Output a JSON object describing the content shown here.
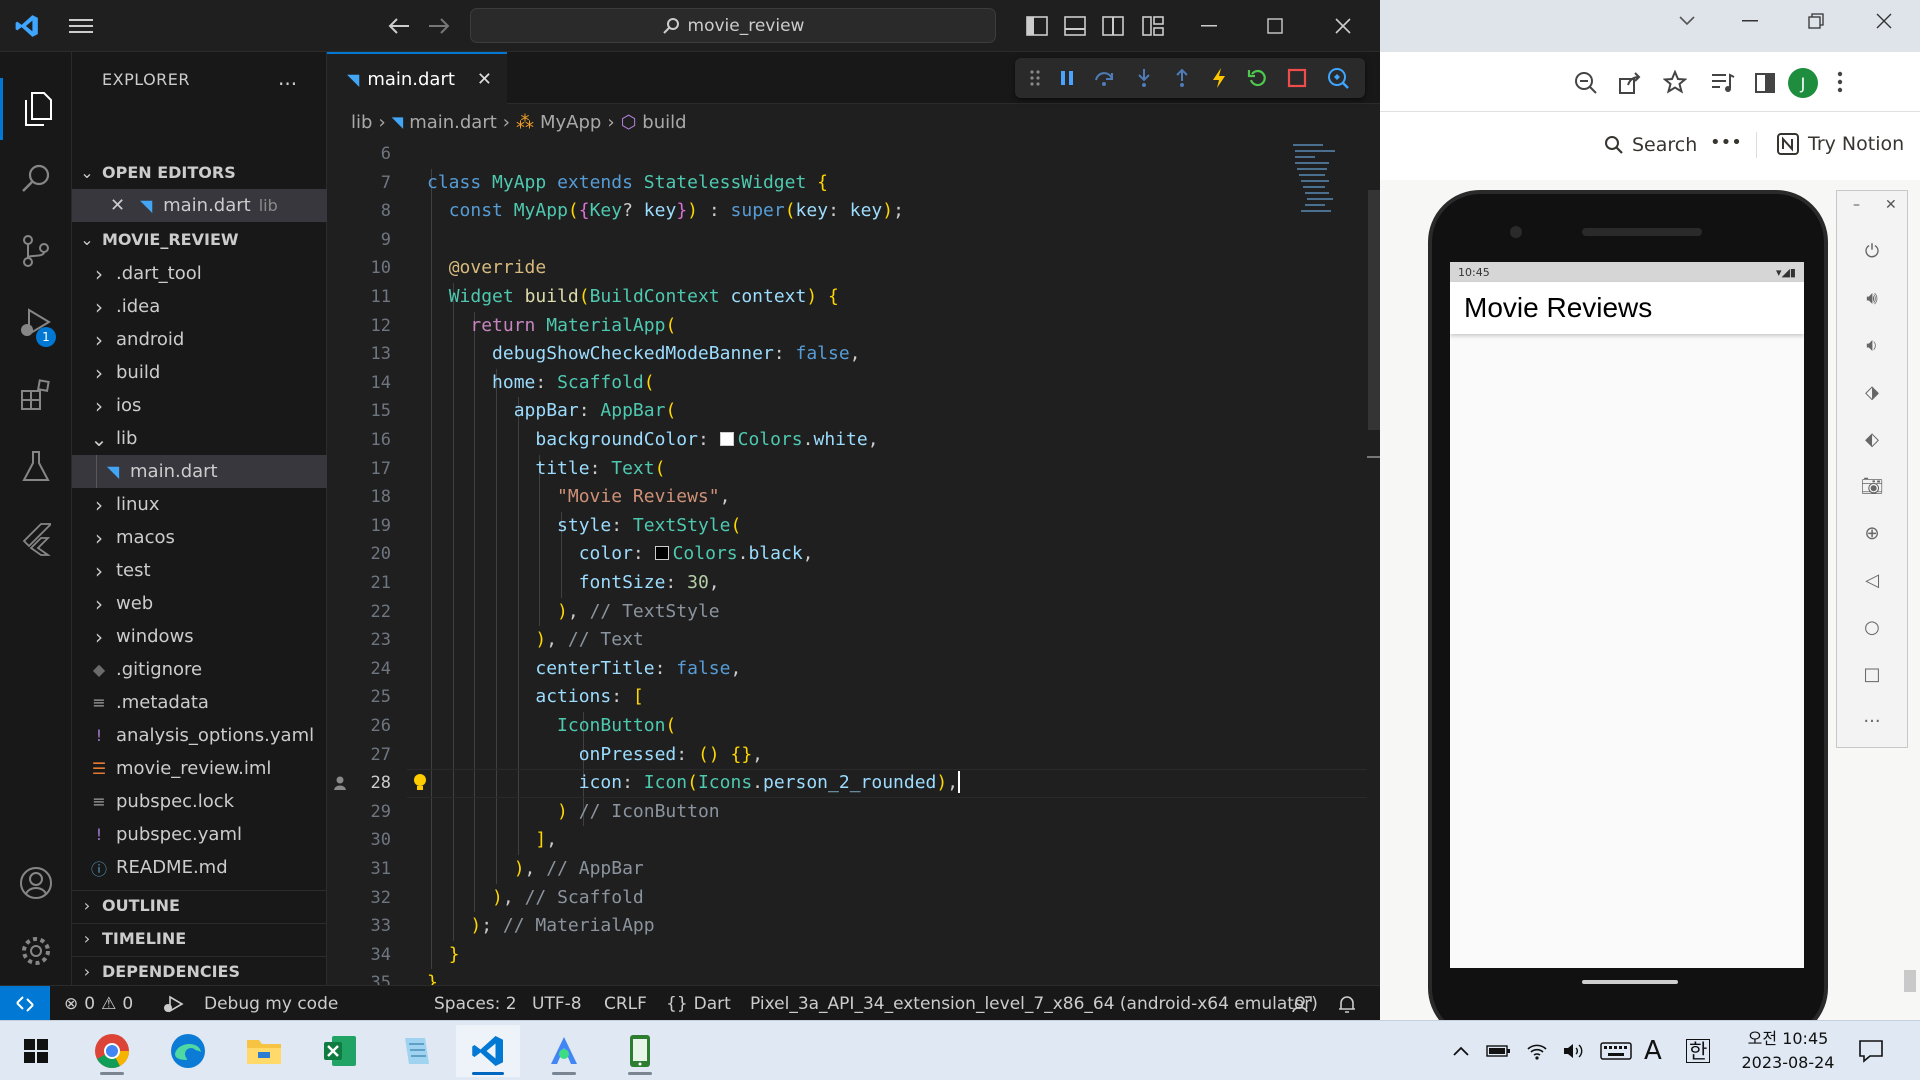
{
  "titlebar": {
    "search_text": "movie_review"
  },
  "activity": {
    "debug_badge": "1"
  },
  "sidebar": {
    "title": "EXPLORER",
    "more": "...",
    "open_editors": {
      "label": "OPEN EDITORS",
      "item": {
        "name": "main.dart",
        "folder": "lib"
      }
    },
    "project": {
      "label": "MOVIE_REVIEW",
      "items": [
        {
          "label": ".dart_tool",
          "kind": "folder"
        },
        {
          "label": ".idea",
          "kind": "folder"
        },
        {
          "label": "android",
          "kind": "folder"
        },
        {
          "label": "build",
          "kind": "folder"
        },
        {
          "label": "ios",
          "kind": "folder"
        },
        {
          "label": "lib",
          "kind": "folder-open"
        },
        {
          "label": "main.dart",
          "kind": "dart"
        },
        {
          "label": "linux",
          "kind": "folder"
        },
        {
          "label": "macos",
          "kind": "folder"
        },
        {
          "label": "test",
          "kind": "folder"
        },
        {
          "label": "web",
          "kind": "folder"
        },
        {
          "label": "windows",
          "kind": "folder"
        },
        {
          "label": ".gitignore",
          "kind": "git"
        },
        {
          "label": ".metadata",
          "kind": "lines"
        },
        {
          "label": "analysis_options.yaml",
          "kind": "yaml"
        },
        {
          "label": "movie_review.iml",
          "kind": "rss"
        },
        {
          "label": "pubspec.lock",
          "kind": "lines"
        },
        {
          "label": "pubspec.yaml",
          "kind": "yaml"
        },
        {
          "label": "README.md",
          "kind": "info"
        }
      ]
    },
    "outline": "OUTLINE",
    "timeline": "TIMELINE",
    "dependencies": "DEPENDENCIES"
  },
  "editor": {
    "tab_label": "main.dart",
    "breadcrumb": {
      "folder": "lib",
      "file": "main.dart",
      "class": "MyApp",
      "method": "build"
    },
    "current_line": 28,
    "lines": [
      {
        "n": 6,
        "text": ""
      },
      {
        "n": 7,
        "text": "class MyApp extends StatelessWidget {"
      },
      {
        "n": 8,
        "text": "  const MyApp({Key? key}) : super(key: key);"
      },
      {
        "n": 9,
        "text": ""
      },
      {
        "n": 10,
        "text": "  @override"
      },
      {
        "n": 11,
        "text": "  Widget build(BuildContext context) {"
      },
      {
        "n": 12,
        "text": "    return MaterialApp("
      },
      {
        "n": 13,
        "text": "      debugShowCheckedModeBanner: false,"
      },
      {
        "n": 14,
        "text": "      home: Scaffold("
      },
      {
        "n": 15,
        "text": "        appBar: AppBar("
      },
      {
        "n": 16,
        "text": "          backgroundColor: Colors.white,"
      },
      {
        "n": 17,
        "text": "          title: Text("
      },
      {
        "n": 18,
        "text": "            \"Movie Reviews\","
      },
      {
        "n": 19,
        "text": "            style: TextStyle("
      },
      {
        "n": 20,
        "text": "              color: Colors.black,"
      },
      {
        "n": 21,
        "text": "              fontSize: 30,"
      },
      {
        "n": 22,
        "text": "            ), // TextStyle"
      },
      {
        "n": 23,
        "text": "          ), // Text"
      },
      {
        "n": 24,
        "text": "          centerTitle: false,"
      },
      {
        "n": 25,
        "text": "          actions: ["
      },
      {
        "n": 26,
        "text": "            IconButton("
      },
      {
        "n": 27,
        "text": "              onPressed: () {},"
      },
      {
        "n": 28,
        "text": "              icon: Icon(Icons.person_2_rounded),"
      },
      {
        "n": 29,
        "text": "            ) // IconButton"
      },
      {
        "n": 30,
        "text": "          ],"
      },
      {
        "n": 31,
        "text": "        ), // AppBar"
      },
      {
        "n": 32,
        "text": "      ), // Scaffold"
      },
      {
        "n": 33,
        "text": "    ); // MaterialApp"
      },
      {
        "n": 34,
        "text": "  }"
      },
      {
        "n": 35,
        "text": "}"
      }
    ]
  },
  "statusbar": {
    "errors": "0",
    "warnings": "0",
    "debug_label": "Debug my code",
    "spaces": "Spaces: 2",
    "encoding": "UTF-8",
    "eol": "CRLF",
    "language": "Dart",
    "device": "Pixel_3a_API_34_extension_level_7_x86_64 (android-x64 emulator)"
  },
  "browser": {
    "search_label": "Search",
    "more": "•••",
    "try_notion": "Try Notion",
    "profile_initial": "J"
  },
  "phone": {
    "status_time": "10:45",
    "app_title": "Movie Reviews"
  },
  "taskbar": {
    "ime_mode": "A",
    "ime_lang": "한",
    "time": "오전 10:45",
    "date": "2023-08-24"
  },
  "colors": {
    "accent": "#0078d4",
    "vscode_bg": "#1f1f1f",
    "taskbar_bg": "#dfe8f3"
  }
}
